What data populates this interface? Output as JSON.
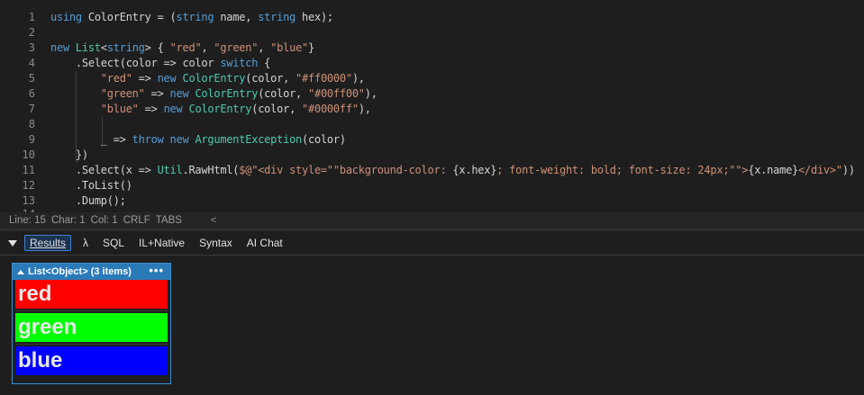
{
  "editor": {
    "lines": [
      {
        "n": "1",
        "tokens": [
          {
            "t": "using",
            "c": "kw"
          },
          {
            "t": " ColorEntry = (",
            "c": "plain"
          },
          {
            "t": "string",
            "c": "kw"
          },
          {
            "t": " name, ",
            "c": "plain"
          },
          {
            "t": "string",
            "c": "kw"
          },
          {
            "t": " hex);",
            "c": "plain"
          }
        ]
      },
      {
        "n": "2",
        "tokens": []
      },
      {
        "n": "3",
        "tokens": [
          {
            "t": "new",
            "c": "kw"
          },
          {
            "t": " ",
            "c": "plain"
          },
          {
            "t": "List",
            "c": "type"
          },
          {
            "t": "<",
            "c": "plain"
          },
          {
            "t": "string",
            "c": "kw"
          },
          {
            "t": "> { ",
            "c": "plain"
          },
          {
            "t": "\"red\"",
            "c": "str"
          },
          {
            "t": ", ",
            "c": "plain"
          },
          {
            "t": "\"green\"",
            "c": "str"
          },
          {
            "t": ", ",
            "c": "plain"
          },
          {
            "t": "\"blue\"",
            "c": "str"
          },
          {
            "t": "}",
            "c": "plain"
          }
        ]
      },
      {
        "n": "4",
        "tokens": [
          {
            "t": "    .Select(color => color ",
            "c": "plain"
          },
          {
            "t": "switch",
            "c": "kw"
          },
          {
            "t": " {",
            "c": "plain"
          }
        ]
      },
      {
        "n": "5",
        "tokens": [
          {
            "t": "        ",
            "c": "plain"
          },
          {
            "t": "\"red\"",
            "c": "str"
          },
          {
            "t": " => ",
            "c": "plain"
          },
          {
            "t": "new",
            "c": "kw"
          },
          {
            "t": " ",
            "c": "plain"
          },
          {
            "t": "ColorEntry",
            "c": "type"
          },
          {
            "t": "(color, ",
            "c": "plain"
          },
          {
            "t": "\"#ff0000\"",
            "c": "str"
          },
          {
            "t": "),",
            "c": "plain"
          }
        ]
      },
      {
        "n": "6",
        "tokens": [
          {
            "t": "        ",
            "c": "plain"
          },
          {
            "t": "\"green\"",
            "c": "str"
          },
          {
            "t": " => ",
            "c": "plain"
          },
          {
            "t": "new",
            "c": "kw"
          },
          {
            "t": " ",
            "c": "plain"
          },
          {
            "t": "ColorEntry",
            "c": "type"
          },
          {
            "t": "(color, ",
            "c": "plain"
          },
          {
            "t": "\"#00ff00\"",
            "c": "str"
          },
          {
            "t": "),",
            "c": "plain"
          }
        ]
      },
      {
        "n": "7",
        "tokens": [
          {
            "t": "        ",
            "c": "plain"
          },
          {
            "t": "\"blue\"",
            "c": "str"
          },
          {
            "t": " => ",
            "c": "plain"
          },
          {
            "t": "new",
            "c": "kw"
          },
          {
            "t": " ",
            "c": "plain"
          },
          {
            "t": "ColorEntry",
            "c": "type"
          },
          {
            "t": "(color, ",
            "c": "plain"
          },
          {
            "t": "\"#0000ff\"",
            "c": "str"
          },
          {
            "t": "),",
            "c": "plain"
          }
        ]
      },
      {
        "n": "8",
        "tokens": []
      },
      {
        "n": "9",
        "tokens": [
          {
            "t": "        _ => ",
            "c": "plain"
          },
          {
            "t": "throw",
            "c": "kw"
          },
          {
            "t": " ",
            "c": "plain"
          },
          {
            "t": "new",
            "c": "kw"
          },
          {
            "t": " ",
            "c": "plain"
          },
          {
            "t": "ArgumentException",
            "c": "type"
          },
          {
            "t": "(color)",
            "c": "plain"
          }
        ]
      },
      {
        "n": "10",
        "tokens": [
          {
            "t": "    })",
            "c": "plain"
          }
        ]
      },
      {
        "n": "11",
        "tokens": [
          {
            "t": "    .Select(x => ",
            "c": "plain"
          },
          {
            "t": "Util",
            "c": "type"
          },
          {
            "t": ".RawHtml(",
            "c": "plain"
          },
          {
            "t": "$@\"<div style=\"\"background-color: ",
            "c": "str"
          },
          {
            "t": "{x.hex}",
            "c": "plain"
          },
          {
            "t": "; font-weight: bold; font-size: 24px;\"\">",
            "c": "str"
          },
          {
            "t": "{x.name}",
            "c": "plain"
          },
          {
            "t": "</div>\"",
            "c": "str"
          },
          {
            "t": "))",
            "c": "plain"
          }
        ]
      },
      {
        "n": "12",
        "tokens": [
          {
            "t": "    .ToList()",
            "c": "plain"
          }
        ]
      },
      {
        "n": "13",
        "tokens": [
          {
            "t": "    .Dump();",
            "c": "plain"
          }
        ]
      }
    ],
    "colors": {
      "kw": "#569cd6",
      "str": "#ce9178",
      "type": "#4ec9b0",
      "plain": "#d4d4d4"
    }
  },
  "status": {
    "line": "Line: 15",
    "char": "Char: 1",
    "col": "Col: 1",
    "eol": "CRLF",
    "indent": "TABS",
    "collapse": "<"
  },
  "toolbar": {
    "tabs": [
      "Results",
      "λ",
      "SQL",
      "IL+Native",
      "Syntax",
      "AI Chat"
    ],
    "active": "Results"
  },
  "results": {
    "header": "List<Object> (3 items)",
    "more": "•••",
    "items": [
      {
        "name": "red",
        "hex": "#ff0000"
      },
      {
        "name": "green",
        "hex": "#00ff00"
      },
      {
        "name": "blue",
        "hex": "#0000ff"
      }
    ]
  }
}
